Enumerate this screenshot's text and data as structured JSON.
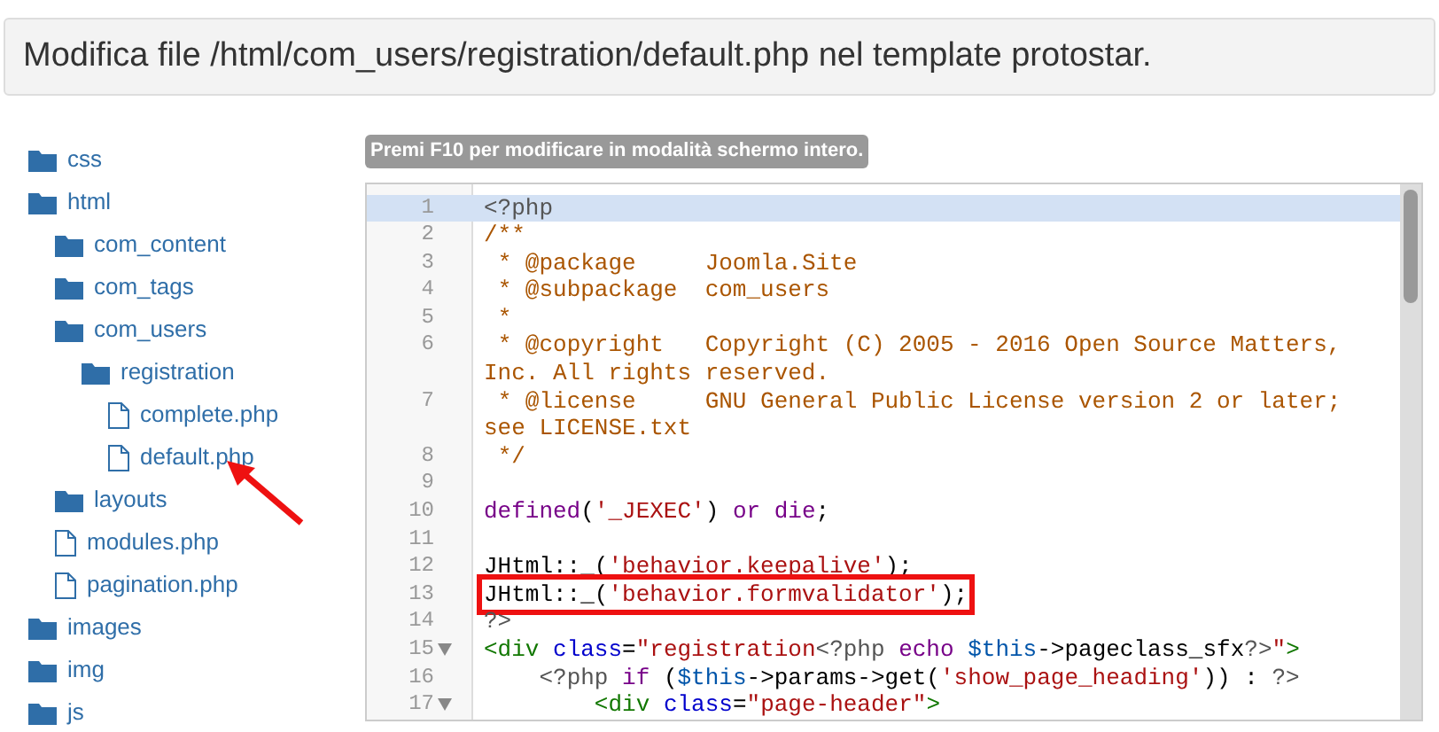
{
  "header": {
    "title": "Modifica file /html/com_users/registration/default.php nel template protostar."
  },
  "tree": [
    {
      "kind": "folder",
      "label": "css"
    },
    {
      "kind": "folder",
      "label": "html",
      "children": [
        {
          "kind": "folder",
          "label": "com_content"
        },
        {
          "kind": "folder",
          "label": "com_tags"
        },
        {
          "kind": "folder",
          "label": "com_users",
          "children": [
            {
              "kind": "folder",
              "label": "registration",
              "children": [
                {
                  "kind": "file",
                  "label": "complete.php"
                },
                {
                  "kind": "file",
                  "label": "default.php",
                  "pointed": true
                }
              ]
            }
          ]
        },
        {
          "kind": "folder",
          "label": "layouts"
        },
        {
          "kind": "file",
          "label": "modules.php"
        },
        {
          "kind": "file",
          "label": "pagination.php"
        }
      ]
    },
    {
      "kind": "folder",
      "label": "images"
    },
    {
      "kind": "folder",
      "label": "img"
    },
    {
      "kind": "folder",
      "label": "js"
    }
  ],
  "editor": {
    "hint": "Premi F10 per modificare in modalità schermo intero.",
    "lines": [
      {
        "number": "1",
        "active": true,
        "tokens": [
          {
            "kind": "meta",
            "text": "<?php"
          }
        ]
      },
      {
        "number": "2",
        "tokens": [
          {
            "kind": "comment",
            "text": "/**"
          }
        ]
      },
      {
        "number": "3",
        "tokens": [
          {
            "kind": "comment",
            "text": " * @package     Joomla.Site"
          }
        ]
      },
      {
        "number": "4",
        "tokens": [
          {
            "kind": "comment",
            "text": " * @subpackage  com_users"
          }
        ]
      },
      {
        "number": "5",
        "tokens": [
          {
            "kind": "comment",
            "text": " *"
          }
        ]
      },
      {
        "number": "6",
        "tokens": [
          {
            "kind": "comment",
            "text": " * @copyright   Copyright (C) 2005 - 2016 Open Source Matters, Inc. All rights reserved."
          }
        ]
      },
      {
        "number": "7",
        "tokens": [
          {
            "kind": "comment",
            "text": " * @license     GNU General Public License version 2 or later; see LICENSE.txt"
          }
        ]
      },
      {
        "number": "8",
        "tokens": [
          {
            "kind": "comment",
            "text": " */"
          }
        ]
      },
      {
        "number": "9"
      },
      {
        "number": "10",
        "tokens": [
          {
            "kind": "keyword",
            "text": "defined"
          },
          {
            "kind": "plain",
            "text": "("
          },
          {
            "kind": "string",
            "text": "'_JEXEC'"
          },
          {
            "kind": "plain",
            "text": ") "
          },
          {
            "kind": "keyword",
            "text": "or"
          },
          {
            "kind": "keyword",
            "text": " die"
          },
          {
            "kind": "plain",
            "text": ";"
          }
        ]
      },
      {
        "number": "11"
      },
      {
        "number": "12",
        "tokens": [
          {
            "kind": "plain",
            "text": "JHtml::_("
          },
          {
            "kind": "string",
            "text": "'behavior.keepalive'"
          },
          {
            "kind": "plain",
            "text": ");"
          }
        ]
      },
      {
        "number": "13",
        "highlighted": true,
        "tokens": [
          {
            "kind": "plain",
            "text": "JHtml::_("
          },
          {
            "kind": "string",
            "text": "'behavior.formvalidator'"
          },
          {
            "kind": "plain",
            "text": ");"
          }
        ]
      },
      {
        "number": "14",
        "tokens": [
          {
            "kind": "meta",
            "text": "?>"
          }
        ]
      },
      {
        "number": "15",
        "foldable": true,
        "tokens": [
          {
            "kind": "tag",
            "text": "<div"
          },
          {
            "kind": "attr",
            "text": " class"
          },
          {
            "kind": "plain",
            "text": "="
          },
          {
            "kind": "string",
            "text": "\"registration"
          },
          {
            "kind": "meta",
            "text": "<?php"
          },
          {
            "kind": "keyword",
            "text": " echo"
          },
          {
            "kind": "variable",
            "text": " $this"
          },
          {
            "kind": "plain",
            "text": "->pageclass_sfx"
          },
          {
            "kind": "meta",
            "text": "?>"
          },
          {
            "kind": "string",
            "text": "\""
          },
          {
            "kind": "tag",
            "text": ">"
          }
        ]
      },
      {
        "number": "16",
        "tokens": [
          {
            "kind": "meta",
            "text": "    <?php"
          },
          {
            "kind": "keyword",
            "text": " if"
          },
          {
            "kind": "plain",
            "text": " ("
          },
          {
            "kind": "variable",
            "text": "$this"
          },
          {
            "kind": "plain",
            "text": "->params->get("
          },
          {
            "kind": "string",
            "text": "'show_page_heading'"
          },
          {
            "kind": "plain",
            "text": ")) : "
          },
          {
            "kind": "meta",
            "text": "?>"
          }
        ]
      },
      {
        "number": "17",
        "foldable": true,
        "tokens": [
          {
            "kind": "tag",
            "text": "        <div"
          },
          {
            "kind": "attr",
            "text": " class"
          },
          {
            "kind": "plain",
            "text": "="
          },
          {
            "kind": "string",
            "text": "\"page-header\""
          },
          {
            "kind": "tag",
            "text": ">"
          }
        ]
      }
    ]
  }
}
